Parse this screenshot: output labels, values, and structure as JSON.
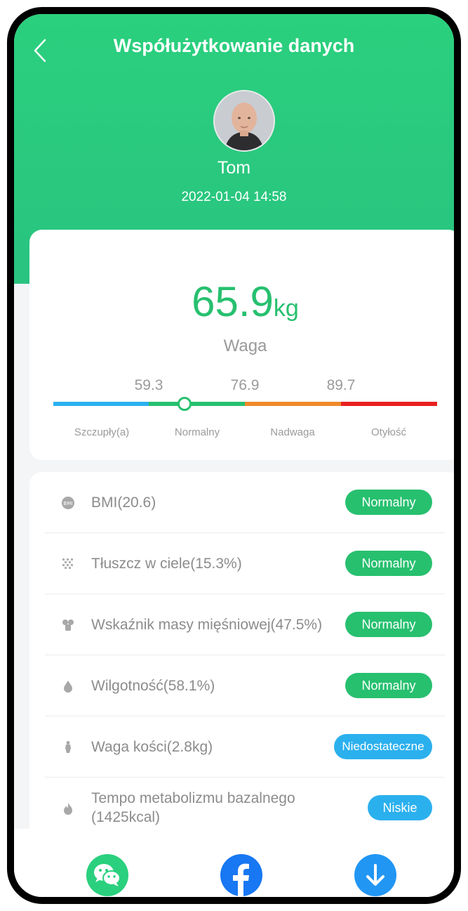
{
  "header": {
    "title": "Współużytkowanie danych",
    "back_icon": "chevron-left-icon"
  },
  "user": {
    "name": "Tom",
    "datetime": "2022-01-04 14:58"
  },
  "weight": {
    "value": "65.9",
    "unit": "kg",
    "label": "Waga",
    "thresholds": [
      "59.3",
      "76.9",
      "89.7"
    ],
    "categories": [
      "Szczupły(a)",
      "Normalny",
      "Nadwaga",
      "Otyłość"
    ],
    "colors": [
      "#2bb0ee",
      "#27c06f",
      "#f08a2a",
      "#e82020"
    ]
  },
  "metrics": [
    {
      "icon": "bmi-icon",
      "label": "BMI(20.6)",
      "status": "Normalny",
      "status_color": "#27c06f"
    },
    {
      "icon": "fat-icon",
      "label": "Tłuszcz w ciele(15.3%)",
      "status": "Normalny",
      "status_color": "#27c06f"
    },
    {
      "icon": "muscle-icon",
      "label": "Wskaźnik masy mięśniowej(47.5%)",
      "status": "Normalny",
      "status_color": "#27c06f"
    },
    {
      "icon": "water-drop-icon",
      "label": "Wilgotność(58.1%)",
      "status": "Normalny",
      "status_color": "#27c06f"
    },
    {
      "icon": "bone-icon",
      "label": "Waga kości(2.8kg)",
      "status": "Niedostateczne",
      "status_color": "#2bb0ee"
    },
    {
      "icon": "flame-icon",
      "label": "Tempo metabolizmu bazalnego (1425kcal)",
      "status": "Niskie",
      "status_color": "#2bb0ee"
    }
  ],
  "share": [
    {
      "icon": "wechat-icon",
      "color": "#2ad07d"
    },
    {
      "icon": "facebook-icon",
      "color": "#1877f2"
    },
    {
      "icon": "download-icon",
      "color": "#2196f3"
    }
  ]
}
